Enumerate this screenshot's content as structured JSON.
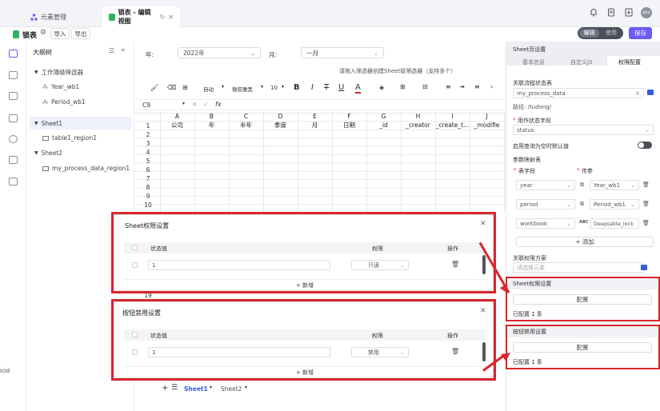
{
  "tabs": {
    "home": "元素管理",
    "active": "锁表 - 编辑视图"
  },
  "top_icons": [
    "bell-icon",
    "document-icon",
    "download-icon"
  ],
  "avatar_text": "ahu",
  "doc": {
    "title": "锁表",
    "import_label": "导入",
    "export_label": "导出"
  },
  "mode_toggle": {
    "edit": "编辑",
    "use": "使用"
  },
  "save_label": "保存",
  "outline": {
    "title": "大纲树",
    "items": [
      "工作簿级筛选器",
      "Year_wb1",
      "Period_wb1",
      "Sheet1",
      "table1_region1",
      "Sheet2",
      "my_process_data_region1"
    ]
  },
  "filters": {
    "year_label": "年:",
    "year_value": "2022年",
    "month_label": "月:",
    "month_value": "一月"
  },
  "hint": "请拖入筛选器创建Sheet级筛选器（支持多个）",
  "toolbar": {
    "zoom": "自动",
    "font": "微软雅黑",
    "size": "10"
  },
  "formula": {
    "cell": "C9",
    "fx": "fx"
  },
  "columns": [
    "A",
    "B",
    "C",
    "D",
    "E",
    "F",
    "G",
    "H",
    "I",
    "J"
  ],
  "header_row": [
    "公司",
    "年",
    "半年",
    "季度",
    "月",
    "日期",
    "_id",
    "_creator",
    "_create_t...",
    "_modifie"
  ],
  "row_numbers": [
    "1",
    "2",
    "3",
    "4",
    "5",
    "6",
    "7",
    "8",
    "9",
    "10",
    "19"
  ],
  "sheet_tabs": [
    "Sheet1",
    "Sheet2"
  ],
  "left_edge_text": "icid",
  "right_panel": {
    "title": "Sheet页设置",
    "tabs": [
      "基本信息",
      "自定义JS",
      "权限配置"
    ],
    "flow_table_label": "关联流程状态表",
    "flow_table_value": "my_process_data",
    "path_label": "路径: /tudong/",
    "status_field_label": "用作状态字段",
    "status_field_value": "status",
    "empty_default_label": "启用查询为空时默认值",
    "param_map_label": "参数映射表",
    "col_table_field": "表字段",
    "col_param": "传参",
    "mappings": [
      {
        "field": "year",
        "param": "Year_wb1"
      },
      {
        "field": "period",
        "param": "Period_wb1"
      },
      {
        "field": "workbook",
        "param": "Deeptable_lock"
      }
    ],
    "add_label": "+ 添加",
    "perm_scheme_label": "关联权限方案",
    "perm_scheme_placeholder": "请选择元素",
    "sheet_perm_title": "Sheet权限设置",
    "config_label": "配置",
    "configured": "已配置 1 条",
    "btn_disable_title": "按钮禁用设置"
  },
  "dialog_perm": {
    "title": "Sheet权限设置",
    "col_status": "状态值",
    "col_perm": "权限",
    "col_op": "操作",
    "row_value": "1",
    "row_perm": "只读",
    "add": "+ 新增"
  },
  "dialog_btn": {
    "title": "按钮禁用设置",
    "col_status": "状态值",
    "col_perm": "权限",
    "col_op": "操作",
    "row_value": "1",
    "row_perm": "禁用",
    "add": "+ 新增"
  },
  "colors": {
    "accent": "#6b5cf5",
    "annotation": "#d8262c",
    "toggle_dark": "#4a4f5a"
  }
}
